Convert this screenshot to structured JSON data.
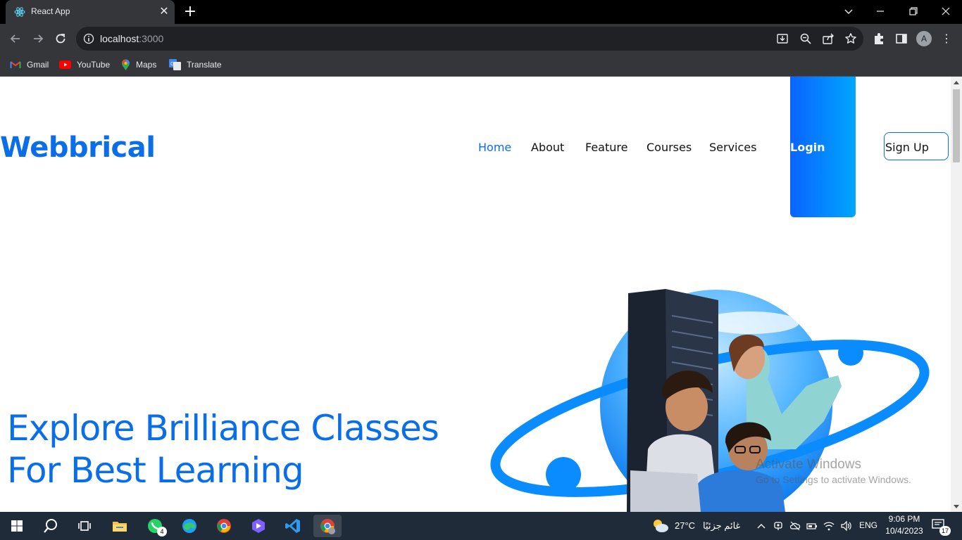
{
  "browser": {
    "tab_title": "React App",
    "url_host": "localhost",
    "url_port": ":3000",
    "avatar_letter": "A",
    "bookmarks": [
      "Gmail",
      "YouTube",
      "Maps",
      "Translate"
    ]
  },
  "site": {
    "logo": "Webbrical",
    "nav": [
      "Home",
      "About",
      "Feature",
      "Courses",
      "Services"
    ],
    "login": "Login",
    "signup": "Sign Up",
    "hero_line1": "Explore Brilliance Classes",
    "hero_line2": "For Best Learning",
    "colors": {
      "brand": "#0a6ee8",
      "login_gradient_start": "#0a64ff",
      "login_gradient_end": "#00a6ff"
    }
  },
  "watermark": {
    "title": "Activate Windows",
    "subtitle": "Go to Settings to activate Windows."
  },
  "taskbar": {
    "weather_temp": "27°C",
    "weather_desc": "غائم جزئيًا",
    "lang": "ENG",
    "time": "9:06 PM",
    "date": "10/4/2023",
    "whatsapp_badge": "4",
    "notification_count": "17"
  }
}
